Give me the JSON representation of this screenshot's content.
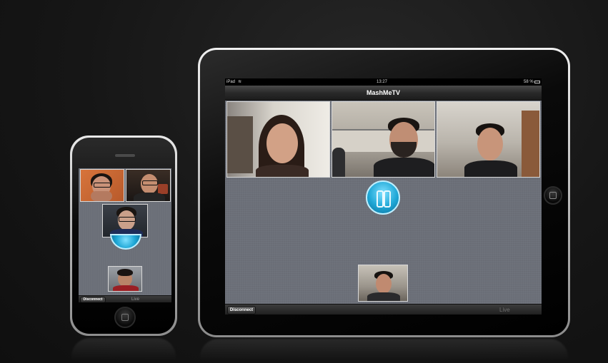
{
  "ipad": {
    "status": {
      "carrier": "iPad",
      "time": "13:27",
      "battery": "58 %"
    },
    "title": "MashMeTV",
    "disconnect_label": "Disconnect",
    "live_label": "Live"
  },
  "iphone": {
    "disconnect_label": "Disconnect",
    "live_label": "Live"
  },
  "colors": {
    "accent": "#1ea7d6",
    "background": "#161616",
    "screen": "#6c7079"
  },
  "icons": [
    "wifi-icon",
    "battery-icon",
    "mashme-logo-icon",
    "home-button-icon"
  ]
}
